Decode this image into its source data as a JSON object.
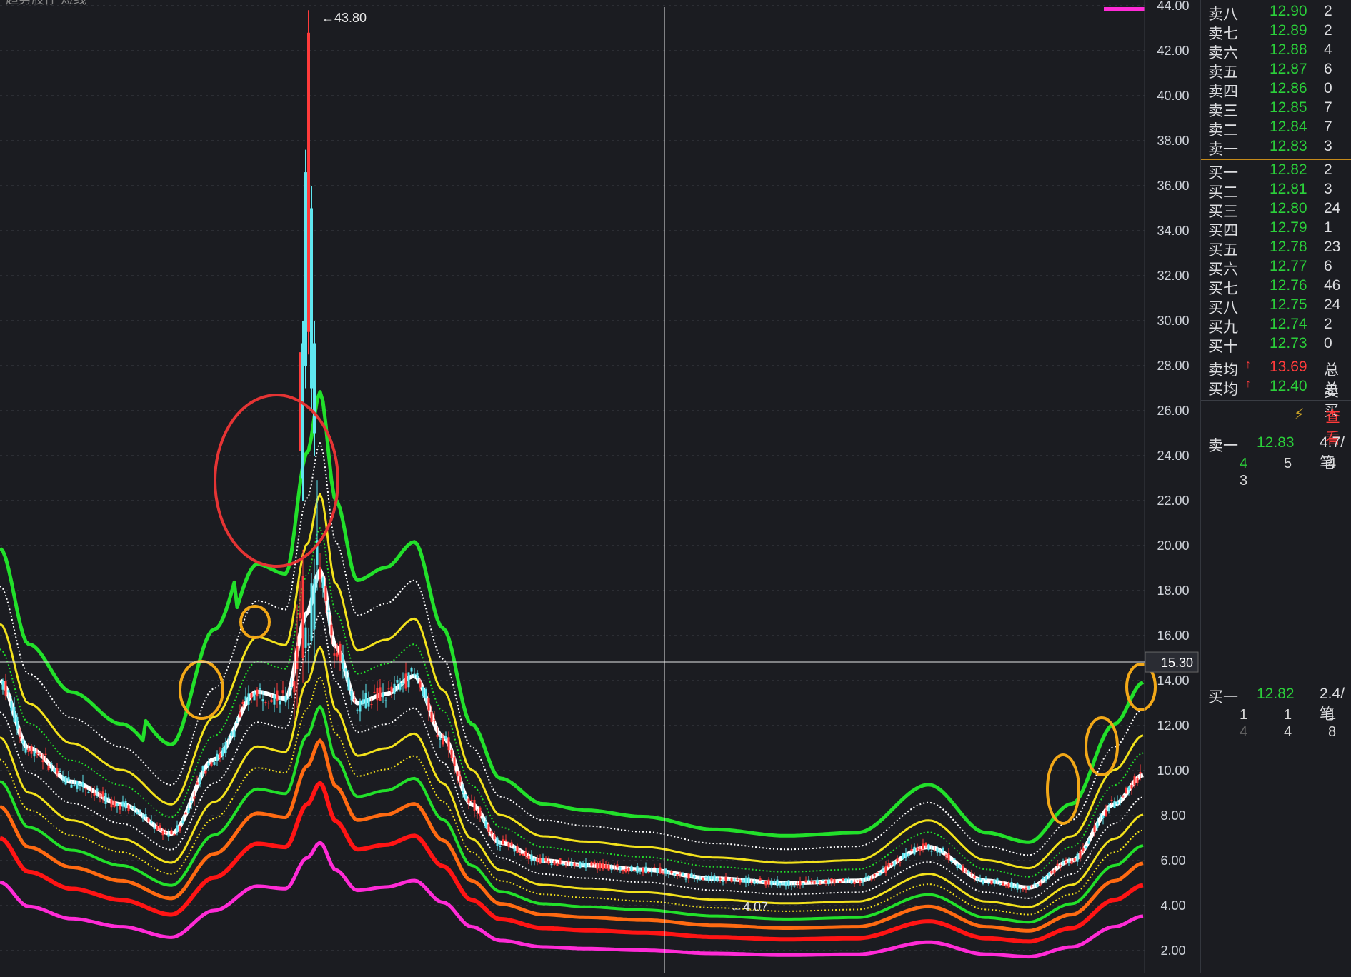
{
  "header": {
    "title_fragment": "趋势股仔 短线"
  },
  "chart": {
    "high_label": "43.80",
    "low_label": "4.07",
    "crosshair_price": "15.30",
    "y_ticks": [
      "44.00",
      "42.00",
      "40.00",
      "38.00",
      "36.00",
      "34.00",
      "32.00",
      "30.00",
      "28.00",
      "26.00",
      "24.00",
      "22.00",
      "20.00",
      "18.00",
      "16.00",
      "14.00",
      "12.00",
      "10.00",
      "8.00",
      "6.00",
      "4.00",
      "2.00"
    ],
    "colors": {
      "background": "#1b1c21",
      "band_green": "#22e02a",
      "band_white": "#ffffff",
      "band_yellow": "#f3e21c",
      "band_orange": "#ff6a12",
      "band_red": "#ff1414",
      "band_magenta": "#ff2bd6",
      "candle_up": "#ff3b3b",
      "candle_down": "#5fe6f0",
      "circle_red": "#e53434",
      "circle_orange": "#f2a818"
    }
  },
  "order_book": {
    "sell": [
      {
        "label": "卖八",
        "price": "12.90",
        "vol": "2"
      },
      {
        "label": "卖七",
        "price": "12.89",
        "vol": "2"
      },
      {
        "label": "卖六",
        "price": "12.88",
        "vol": "4"
      },
      {
        "label": "卖五",
        "price": "12.87",
        "vol": "6"
      },
      {
        "label": "卖四",
        "price": "12.86",
        "vol": "0"
      },
      {
        "label": "卖三",
        "price": "12.85",
        "vol": "7"
      },
      {
        "label": "卖二",
        "price": "12.84",
        "vol": "7"
      },
      {
        "label": "卖一",
        "price": "12.83",
        "vol": "3"
      }
    ],
    "buy": [
      {
        "label": "买一",
        "price": "12.82",
        "vol": "2"
      },
      {
        "label": "买二",
        "price": "12.81",
        "vol": "3"
      },
      {
        "label": "买三",
        "price": "12.80",
        "vol": "24"
      },
      {
        "label": "买四",
        "price": "12.79",
        "vol": "1"
      },
      {
        "label": "买五",
        "price": "12.78",
        "vol": "23"
      },
      {
        "label": "买六",
        "price": "12.77",
        "vol": "6"
      },
      {
        "label": "买七",
        "price": "12.76",
        "vol": "46"
      },
      {
        "label": "买八",
        "price": "12.75",
        "vol": "24"
      },
      {
        "label": "买九",
        "price": "12.74",
        "vol": "2"
      },
      {
        "label": "买十",
        "price": "12.73",
        "vol": "0"
      }
    ],
    "sell_avg": {
      "label": "卖均",
      "price": "13.69",
      "total_label": "总卖"
    },
    "buy_avg": {
      "label": "买均",
      "price": "12.40",
      "total_label": "总买"
    },
    "view_label": "查看",
    "sell1_queue": {
      "label": "卖一",
      "price": "12.83",
      "per": "4.7/笔",
      "row1": [
        "4",
        "5",
        "4"
      ],
      "row2": [
        "3"
      ]
    },
    "buy1_queue": {
      "label": "买一",
      "price": "12.82",
      "per": "2.4/笔",
      "row1": [
        "1",
        "1",
        "1"
      ],
      "row2": [
        "4",
        "4",
        "8"
      ]
    }
  }
}
